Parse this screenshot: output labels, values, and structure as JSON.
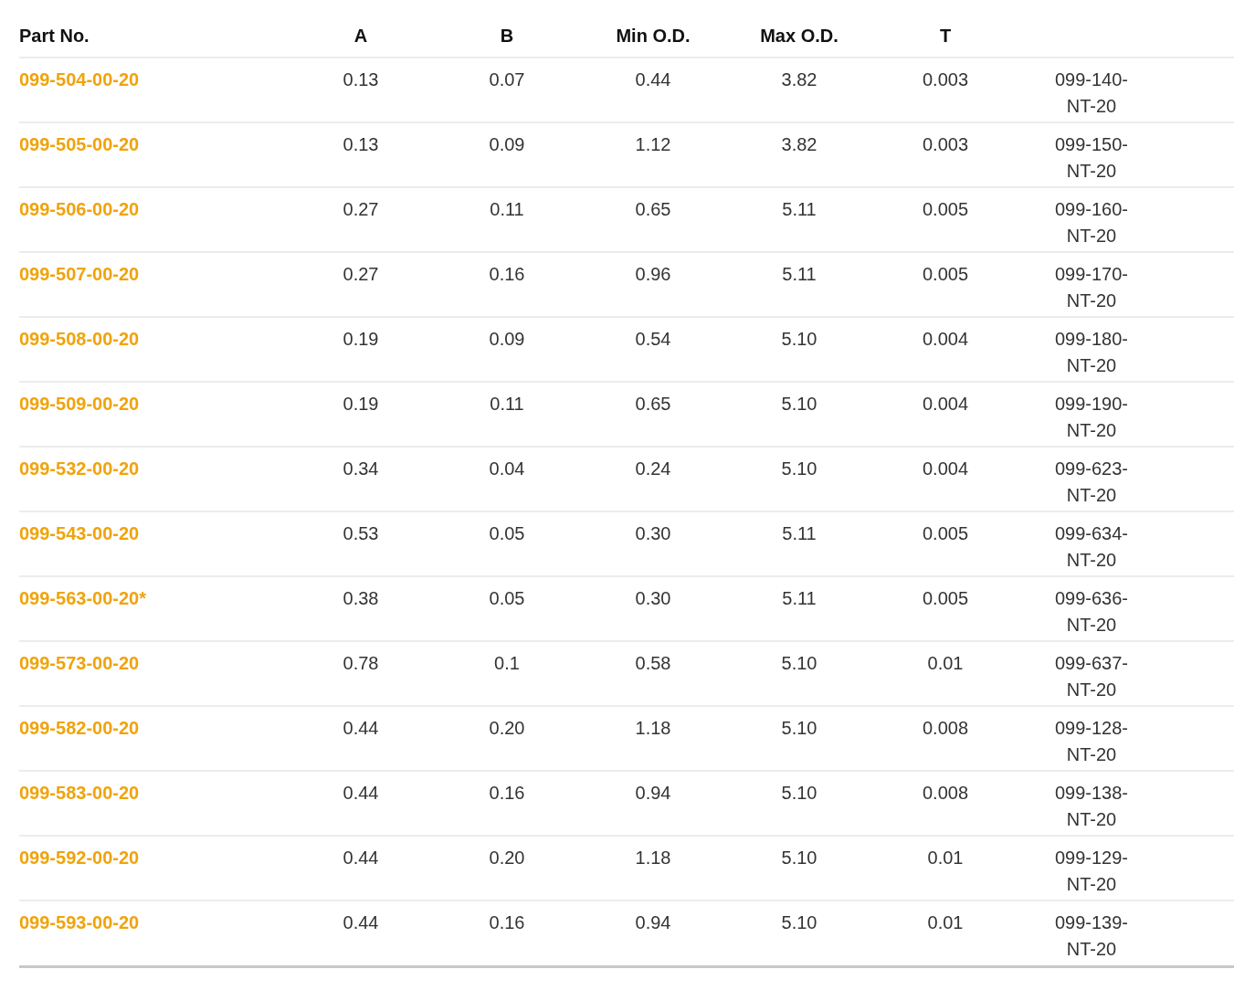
{
  "table": {
    "columns": [
      "Part No.",
      "A",
      "B",
      "Min O.D.",
      "Max O.D.",
      "T"
    ],
    "rows": [
      {
        "part_no": "099-504-00-20",
        "a": "0.13",
        "b": "0.07",
        "min_od": "0.44",
        "max_od": "3.82",
        "t": "0.003",
        "column_7": "099-140-NT-20"
      },
      {
        "part_no": "099-505-00-20",
        "a": "0.13",
        "b": "0.09",
        "min_od": "1.12",
        "max_od": "3.82",
        "t": "0.003",
        "column_7": "099-150-NT-20"
      },
      {
        "part_no": "099-506-00-20",
        "a": "0.27",
        "b": "0.11",
        "min_od": "0.65",
        "max_od": "5.11",
        "t": "0.005",
        "column_7": "099-160-NT-20"
      },
      {
        "part_no": "099-507-00-20",
        "a": "0.27",
        "b": "0.16",
        "min_od": "0.96",
        "max_od": "5.11",
        "t": "0.005",
        "column_7": "099-170-NT-20"
      },
      {
        "part_no": "099-508-00-20",
        "a": "0.19",
        "b": "0.09",
        "min_od": "0.54",
        "max_od": "5.10",
        "t": "0.004",
        "column_7": "099-180-NT-20"
      },
      {
        "part_no": "099-509-00-20",
        "a": "0.19",
        "b": "0.11",
        "min_od": "0.65",
        "max_od": "5.10",
        "t": "0.004",
        "column_7": "099-190-NT-20"
      },
      {
        "part_no": "099-532-00-20",
        "a": "0.34",
        "b": "0.04",
        "min_od": "0.24",
        "max_od": "5.10",
        "t": "0.004",
        "column_7": "099-623-NT-20"
      },
      {
        "part_no": "099-543-00-20",
        "a": "0.53",
        "b": "0.05",
        "min_od": "0.30",
        "max_od": "5.11",
        "t": "0.005",
        "column_7": "099-634-NT-20"
      },
      {
        "part_no": "099-563-00-20*",
        "a": "0.38",
        "b": "0.05",
        "min_od": "0.30",
        "max_od": "5.11",
        "t": "0.005",
        "column_7": "099-636-NT-20"
      },
      {
        "part_no": "099-573-00-20",
        "a": "0.78",
        "b": "0.1",
        "min_od": "0.58",
        "max_od": "5.10",
        "t": "0.01",
        "column_7": "099-637-NT-20"
      },
      {
        "part_no": "099-582-00-20",
        "a": "0.44",
        "b": "0.20",
        "min_od": "1.18",
        "max_od": "5.10",
        "t": "0.008",
        "column_7": "099-128-NT-20"
      },
      {
        "part_no": "099-583-00-20",
        "a": "0.44",
        "b": "0.16",
        "min_od": "0.94",
        "max_od": "5.10",
        "t": "0.008",
        "column_7": "099-138-NT-20"
      },
      {
        "part_no": "099-592-00-20",
        "a": "0.44",
        "b": "0.20",
        "min_od": "1.18",
        "max_od": "5.10",
        "t": "0.01",
        "column_7": "099-129-NT-20"
      },
      {
        "part_no": "099-593-00-20",
        "a": "0.44",
        "b": "0.16",
        "min_od": "0.94",
        "max_od": "5.10",
        "t": "0.01",
        "column_7": "099-139-NT-20"
      }
    ]
  }
}
